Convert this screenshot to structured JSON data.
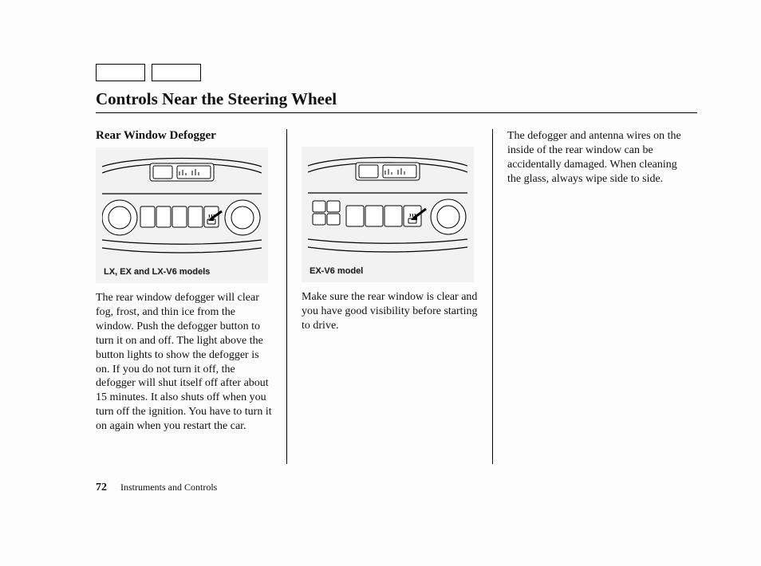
{
  "page_title": "Controls Near the Steering Wheel",
  "subheading": "Rear Window Defogger",
  "figure1_caption": "LX, EX and LX-V6 models",
  "figure2_caption": "EX-V6 model",
  "col1_paragraph": "The rear window defogger will clear fog, frost, and thin ice from the window. Push the defogger button to turn it on and off. The light above the button lights to show the defogger is on. If you do not turn it off, the defogger will shut itself off after about 15 minutes. It also shuts off when you turn off the ignition. You have to turn it on again when you restart the car.",
  "col2_paragraph": "Make sure the rear window is clear and you have good visibility before starting to drive.",
  "col3_paragraph": "The defogger and antenna wires on the inside of the rear window can be accidentally damaged. When cleaning the glass, always wipe side to side.",
  "page_number": "72",
  "footer_section": "Instruments and Controls"
}
